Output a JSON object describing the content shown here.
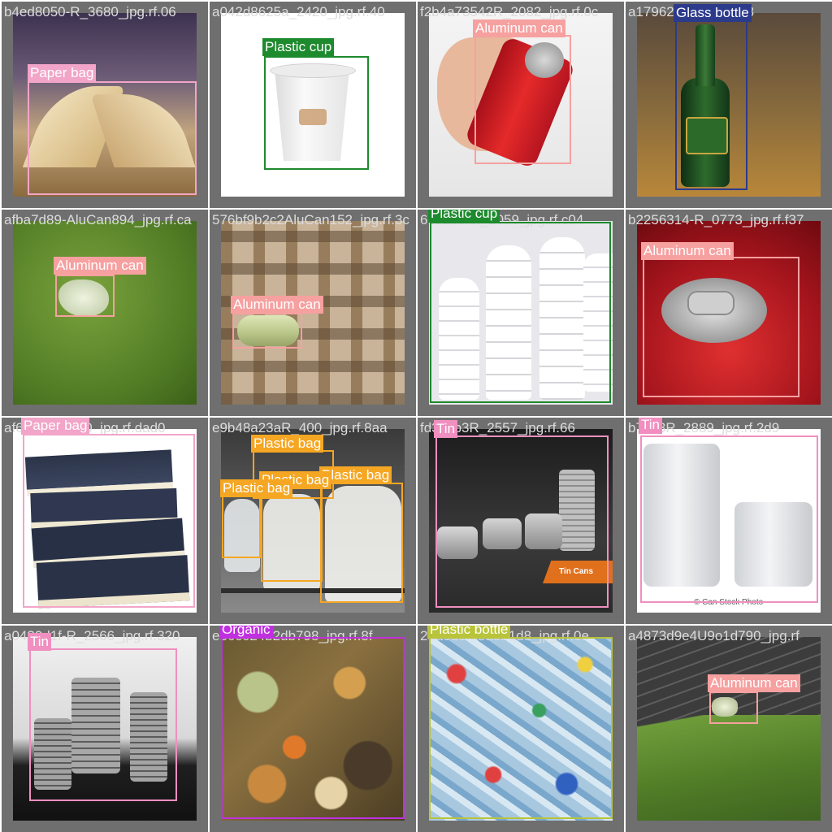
{
  "grid": {
    "tiles": [
      {
        "filename": "b4ed8050-R_3680_jpg.rf.06",
        "labels": [
          "Paper bag"
        ]
      },
      {
        "filename": "a042d8625a_2420_jpg.rf.40",
        "labels": [
          "Plastic cup"
        ]
      },
      {
        "filename": "f2b4a73542R_2082_jpg.rf.0c",
        "labels": [
          "Aluminum can"
        ]
      },
      {
        "filename": "a1796249b_jpg.rf.c8",
        "labels": [
          "Glass bottle"
        ]
      },
      {
        "filename": "afba7d89-AluCan894_jpg.rf.ca",
        "labels": [
          "Aluminum can"
        ]
      },
      {
        "filename": "576bf9b2c2AluCan152_jpg.rf.3c",
        "labels": [
          "Aluminum can"
        ]
      },
      {
        "filename": "6c32b3f3f_2059_jpg.rf.c04",
        "labels": [
          "Plastic cup"
        ]
      },
      {
        "filename": "b2256314-R_0773_jpg.rf.f37",
        "labels": [
          "Aluminum can"
        ]
      },
      {
        "filename": "af6b6e46_710_jpg.rf.dad0",
        "labels": [
          "Paper bag"
        ]
      },
      {
        "filename": "e9b48a23aR_400_jpg.rf.8aa",
        "labels": [
          "Plastic bag",
          "Plastic bag",
          "Plastic bag",
          "Plastic bag"
        ]
      },
      {
        "filename": "fd3c6b3R_2557_jpg.rf.66",
        "labels": [
          "Tin"
        ]
      },
      {
        "filename": "b7dc3R_2889_jpg.rf.2d9",
        "labels": [
          "Tin"
        ]
      },
      {
        "filename": "a0439d1f-R_2566_jpg.rf.320",
        "labels": [
          "Tin"
        ]
      },
      {
        "filename": "e36c624b2db798_jpg.rf.8f",
        "labels": [
          "Organic"
        ]
      },
      {
        "filename": "2aa0d9fa8a3b1d8_jpg.rf.0e",
        "labels": [
          "Plastic bottle"
        ]
      },
      {
        "filename": "a4873d9e4U9o1d790_jpg.rf",
        "labels": [
          "Aluminum can"
        ]
      }
    ]
  },
  "overlay_text": {
    "tin_cans_banner": "Tin Cans",
    "watermark": "© Can Stock Photo"
  },
  "colors": {
    "paper_bag": "#f2a5c8",
    "plastic_cup": "#1e8a2e",
    "aluminum_can": "#f6a0a0",
    "glass_bottle": "#2c3a8c",
    "plastic_bag": "#f5a623",
    "tin": "#f08fc0",
    "organic": "#c030e0",
    "plastic_bottle": "#b9c43a",
    "cell_background": "#6f6f6f"
  }
}
